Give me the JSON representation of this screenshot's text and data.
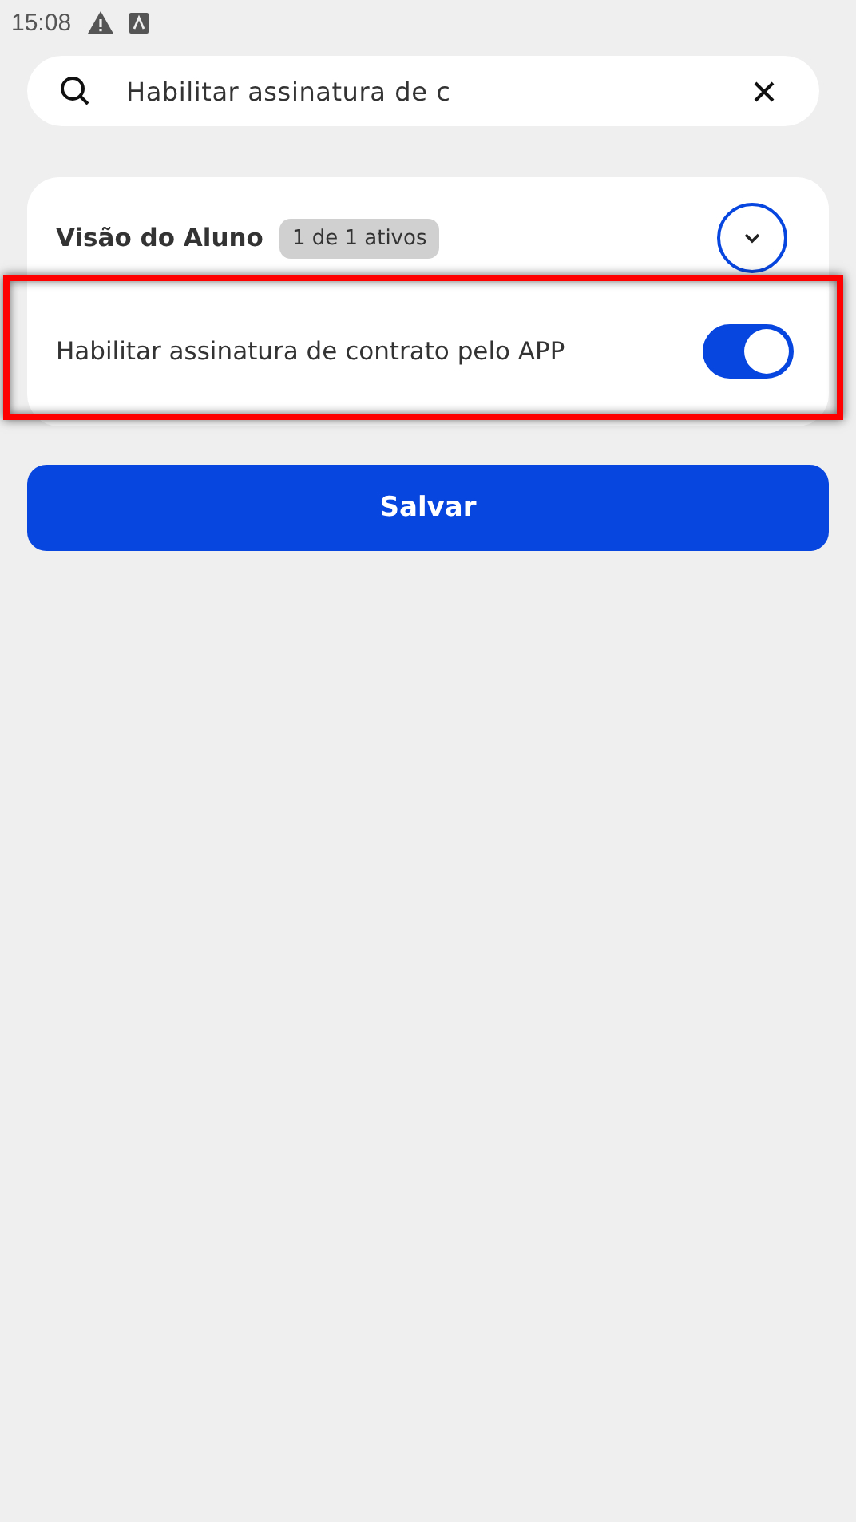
{
  "status_bar": {
    "time": "15:08"
  },
  "search": {
    "value": "Habilitar assinatura de c"
  },
  "section": {
    "title": "Visão do Aluno",
    "badge": "1 de 1 ativos",
    "expanded": true,
    "items": [
      {
        "label": "Habilitar assinatura de contrato pelo APP",
        "on": true,
        "highlighted": true
      }
    ]
  },
  "buttons": [
    {
      "label": "Salvar"
    }
  ]
}
